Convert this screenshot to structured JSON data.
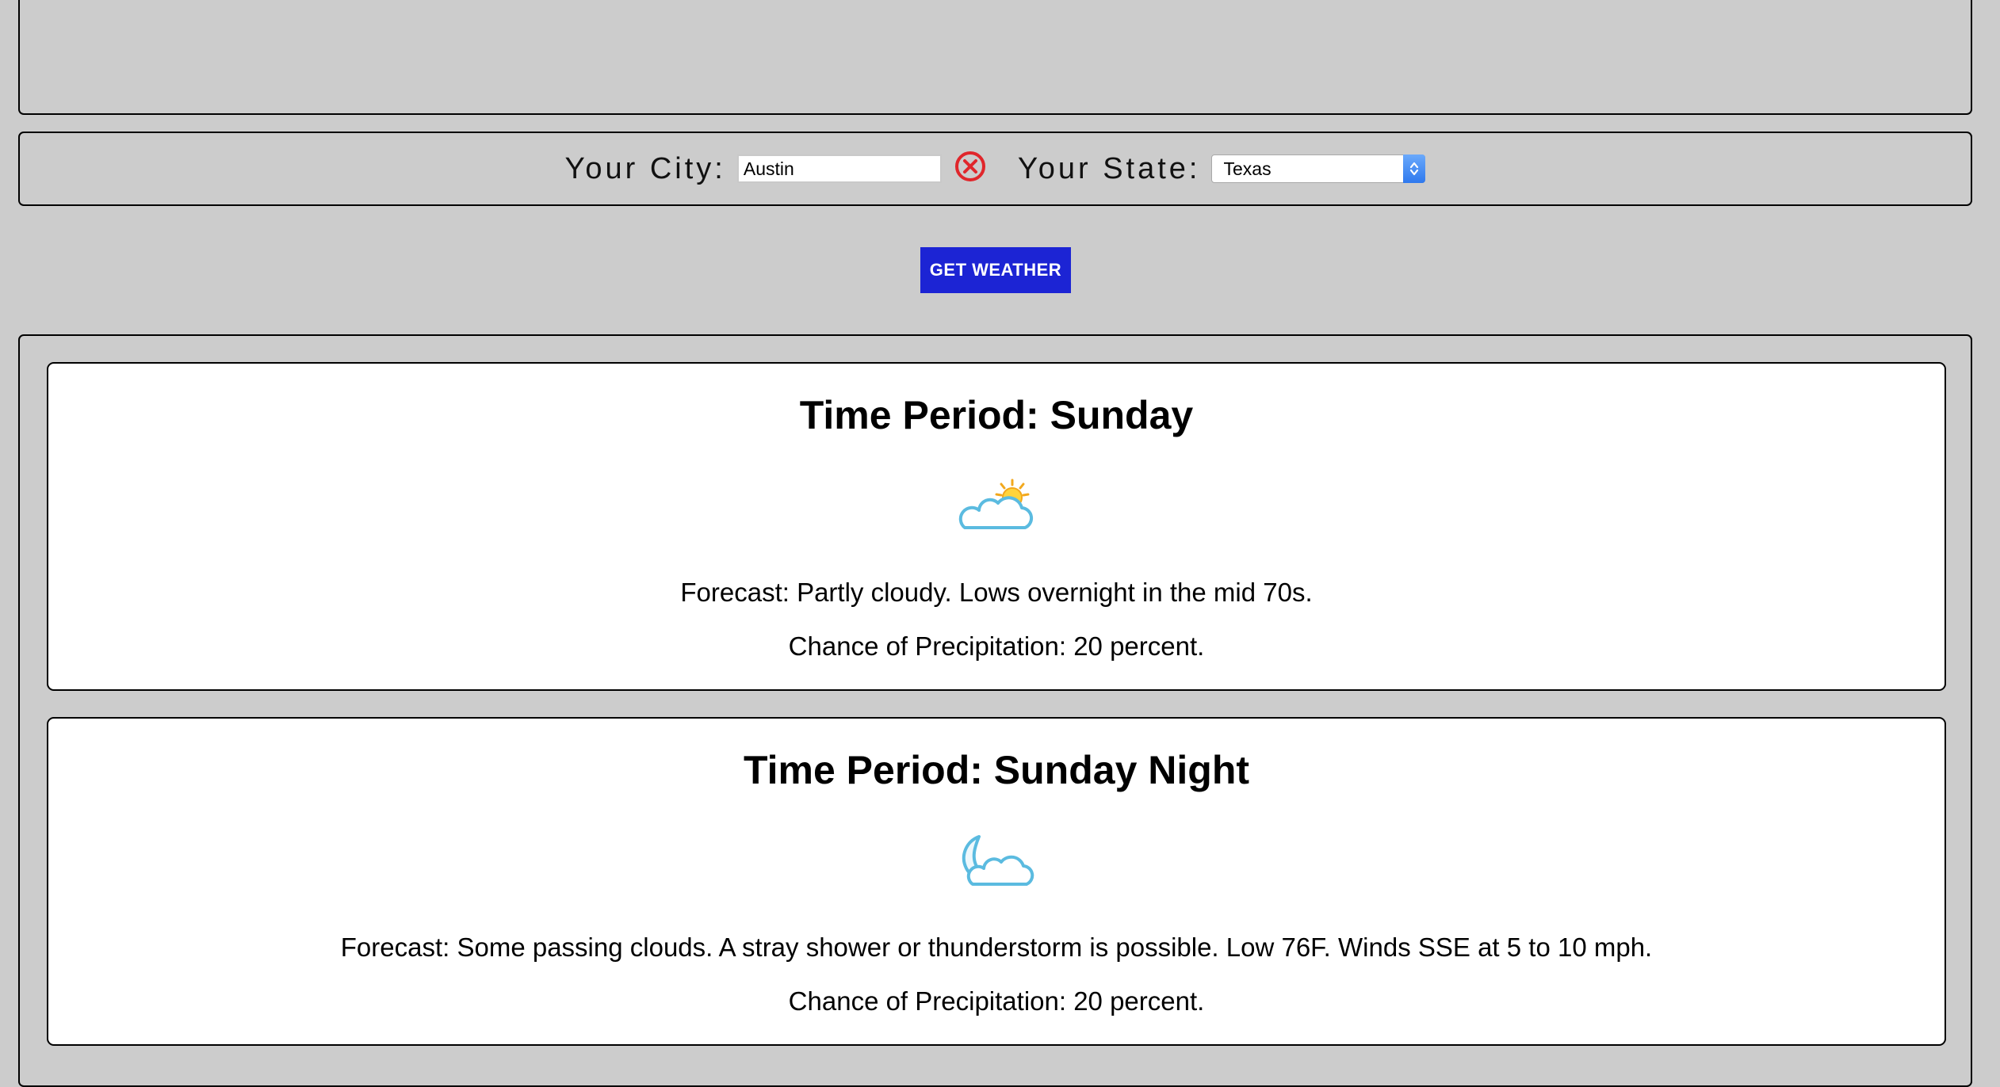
{
  "form": {
    "city_label": "Your City:",
    "city_value": "Austin",
    "clear_icon": "clear-circle-x-icon",
    "state_label": "Your State:",
    "state_selected": "Texas"
  },
  "button": {
    "label": "GET WEATHER",
    "color": "#1c24d4"
  },
  "periods": [
    {
      "title": "Time Period: Sunday",
      "icon": "partly-cloudy-day-icon",
      "forecast": "Forecast: Partly cloudy. Lows overnight in the mid 70s.",
      "precipitation": "Chance of Precipitation: 20 percent."
    },
    {
      "title": "Time Period: Sunday Night",
      "icon": "partly-cloudy-night-icon",
      "forecast": "Forecast: Some passing clouds. A stray shower or thunderstorm is possible. Low 76F. Winds SSE at 5 to 10 mph.",
      "precipitation": "Chance of Precipitation: 20 percent."
    }
  ],
  "colors": {
    "background": "#cccccc",
    "card": "#ffffff",
    "clear_icon": "#e0262b",
    "select_arrows": "#3b82f0"
  }
}
